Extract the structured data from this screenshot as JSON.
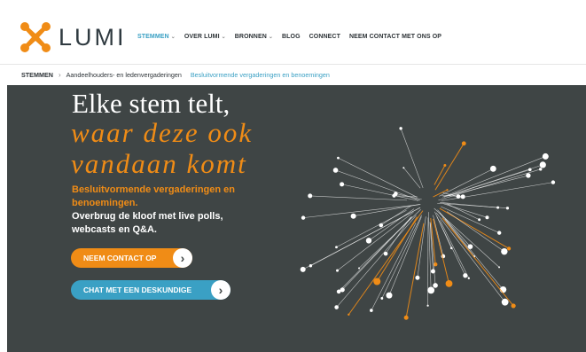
{
  "logo": {
    "text": "LUMI"
  },
  "nav": {
    "items": [
      {
        "label": "STEMMEN",
        "has_chevron": true,
        "active": true
      },
      {
        "label": "OVER LUMI",
        "has_chevron": true
      },
      {
        "label": "BRONNEN",
        "has_chevron": true
      },
      {
        "label": "BLOG",
        "has_chevron": false
      },
      {
        "label": "CONNECT",
        "has_chevron": false
      },
      {
        "label": "NEEM CONTACT MET ONS OP",
        "has_chevron": false
      }
    ]
  },
  "breadcrumb": {
    "root": "STEMMEN",
    "separator": "›",
    "level2": "Aandeelhouders- en ledenvergaderingen",
    "level3": "Besluitvormende vergaderingen en benoemingen"
  },
  "hero": {
    "title_line1": "Elke stem telt,",
    "title_line2": "waar deze ook",
    "title_line3": "vandaan komt",
    "subtitle_orange": "Besluitvormende vergaderingen en benoemingen.",
    "subtitle_white": "Overbrug de kloof met live polls, webcasts en Q&A.",
    "cta_primary": "NEEM CONTACT OP",
    "cta_secondary": "CHAT MET EEN DESKUNDIGE"
  },
  "colors": {
    "accent_orange": "#f08c16",
    "accent_blue": "#3aa0c4",
    "hero_bg": "#3f4545",
    "text_dark": "#2e3438"
  },
  "icons": {
    "logo": "lumi-x-logo-icon",
    "chevron": "chevron-down-icon",
    "arrow": "arrow-right-icon",
    "decoration": "vote-burst-illustration"
  }
}
